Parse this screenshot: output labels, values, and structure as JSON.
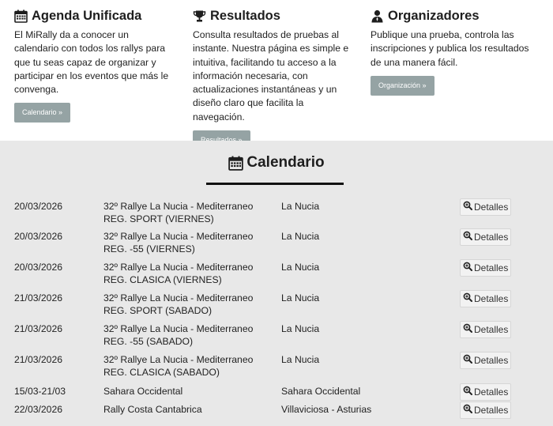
{
  "sections": [
    {
      "title": "Agenda Unificada",
      "icon": "calendar-icon",
      "text": "El MiRally da a conocer un calendario con todos los rallys para que tu seas capaz de organizar y participar en los eventos que más le convenga.",
      "button": "Calendario »"
    },
    {
      "title": "Resultados",
      "icon": "trophy-icon",
      "text": "Consulta resultados de pruebas al instante. Nuestra página es simple e intuitiva, facilitando tu acceso a la información necesaria, con actualizaciones instantáneas y un diseño claro que facilita la navegación.",
      "button": "Resultados »"
    },
    {
      "title": "Organizadores",
      "icon": "user-icon",
      "text": "Publique una prueba, controla las inscripciones y publica los resultados de una manera fácil.",
      "button": "Organización »"
    }
  ],
  "calendar": {
    "title": "Calendario",
    "details_label": "Detalles",
    "rows": [
      {
        "date": "20/03/2026",
        "event": "32º Rallye La Nucia - Mediterraneo REG. SPORT (VIERNES)",
        "place": "La Nucia"
      },
      {
        "date": "20/03/2026",
        "event": "32º Rallye La Nucia - Mediterraneo REG. -55 (VIERNES)",
        "place": "La Nucia"
      },
      {
        "date": "20/03/2026",
        "event": "32º Rallye La Nucia - Mediterraneo REG. CLASICA (VIERNES)",
        "place": "La Nucia"
      },
      {
        "date": "21/03/2026",
        "event": "32º Rallye La Nucia - Mediterraneo REG. SPORT (SABADO)",
        "place": "La Nucia"
      },
      {
        "date": "21/03/2026",
        "event": "32º Rallye La Nucia - Mediterraneo REG. -55 (SABADO)",
        "place": "La Nucia"
      },
      {
        "date": "21/03/2026",
        "event": "32º Rallye La Nucia - Mediterraneo REG. CLASICA (SABADO)",
        "place": "La Nucia"
      },
      {
        "date": "15/03-21/03",
        "event": "Sahara Occidental",
        "place": "Sahara Occidental"
      },
      {
        "date": "22/03/2026",
        "event": "Rally Costa Cantabrica",
        "place": "Villaviciosa - Asturias"
      }
    ]
  }
}
